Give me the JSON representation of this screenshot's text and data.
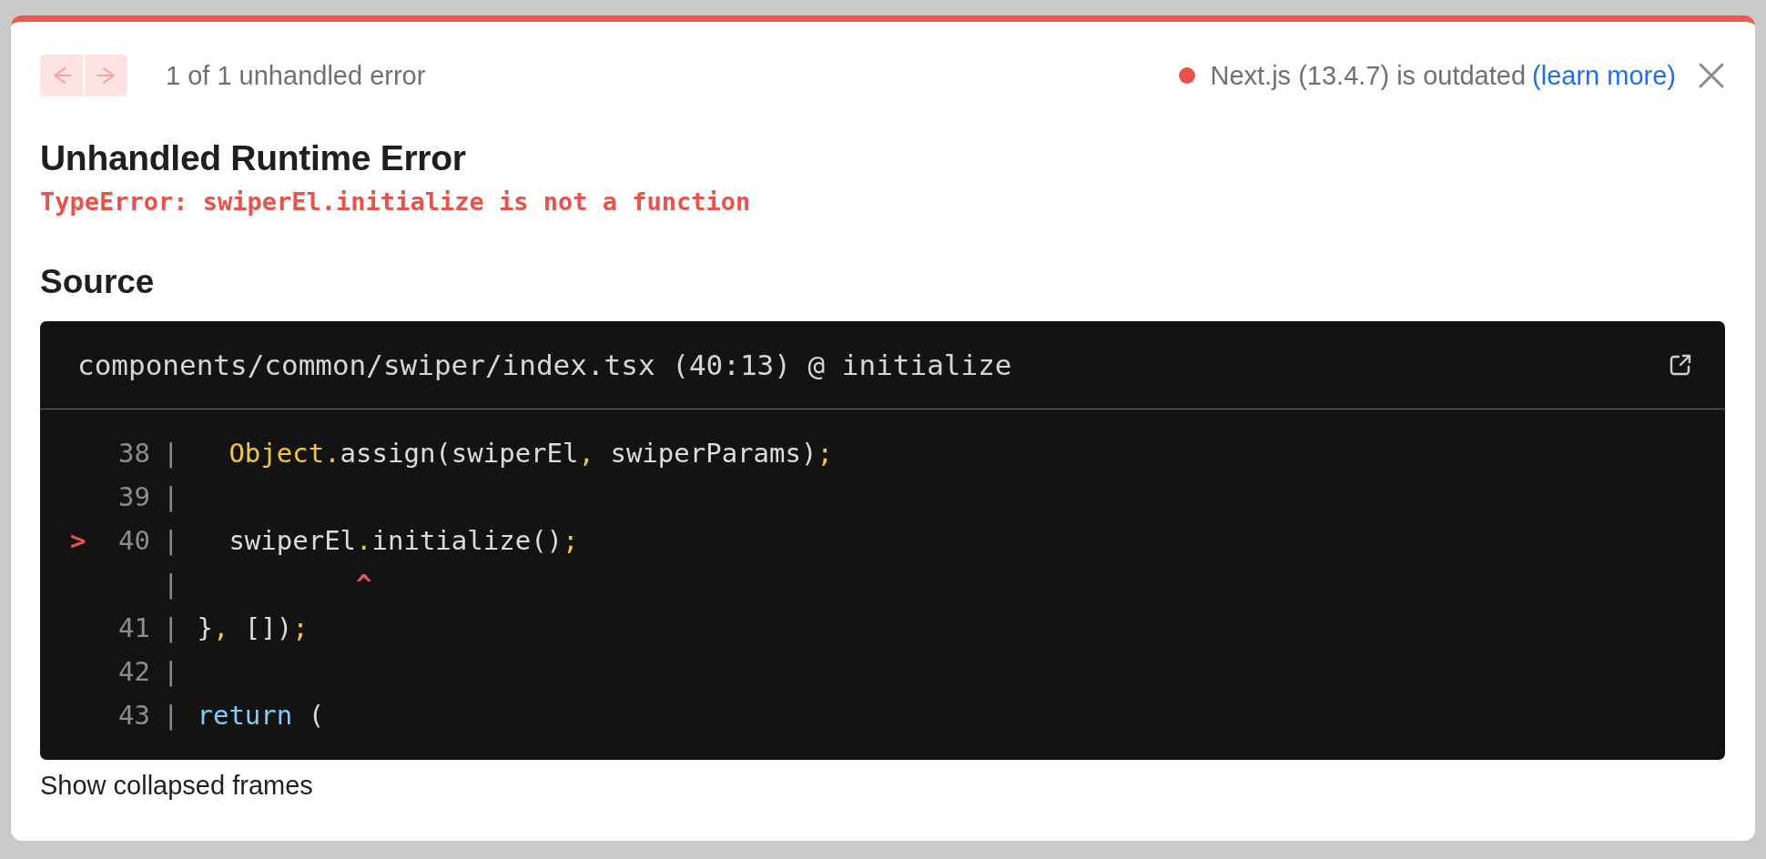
{
  "nav": {
    "buttons": [
      {
        "kind": "prev",
        "disabled": true
      },
      {
        "kind": "next",
        "disabled": true
      }
    ],
    "counter": "1 of 1 unhandled error"
  },
  "version_notice": {
    "color": "#e5534b",
    "text": "Next.js (13.4.7) is outdated",
    "link": "(learn more)"
  },
  "title": "Unhandled Runtime Error",
  "error_message": "TypeError: swiperEl.initialize is not a function",
  "source_heading": "Source",
  "code_frame": {
    "file": "components/common/swiper/index.tsx (40:13) @ initialize",
    "lines": [
      {
        "number": "38",
        "separator": "|",
        "indented": true,
        "tokens": [
          {
            "kind": "accent",
            "text": "Object."
          },
          {
            "kind": "plain",
            "text": "assign(swiperEl"
          },
          {
            "kind": "accent",
            "text": ","
          },
          {
            "kind": "plain",
            "text": " swiperParams)"
          },
          {
            "kind": "accent",
            "text": ";"
          }
        ]
      },
      {
        "number": "39",
        "separator": "|"
      },
      {
        "marker": ">",
        "number": "40",
        "separator": "|",
        "indented": true,
        "tokens": [
          {
            "kind": "plain",
            "text": "swiperEl"
          },
          {
            "kind": "accent",
            "text": "."
          },
          {
            "kind": "plain",
            "text": "initialize()"
          },
          {
            "kind": "accent",
            "text": ";"
          }
        ]
      },
      {
        "separator": "|",
        "tokens": [
          {
            "kind": "caret",
            "text": "^"
          }
        ]
      },
      {
        "number": "41",
        "separator": "|",
        "tokens": [
          {
            "kind": "plain",
            "text": "}"
          },
          {
            "kind": "accent",
            "text": ","
          },
          {
            "kind": "plain",
            "text": " [])"
          },
          {
            "kind": "accent",
            "text": ";"
          }
        ]
      },
      {
        "number": "42",
        "separator": "|"
      },
      {
        "number": "43",
        "separator": "|",
        "tokens": [
          {
            "kind": "keyword",
            "text": "return"
          },
          {
            "kind": "plain",
            "text": " ("
          }
        ]
      }
    ]
  },
  "footer_link": "Show collapsed frames"
}
